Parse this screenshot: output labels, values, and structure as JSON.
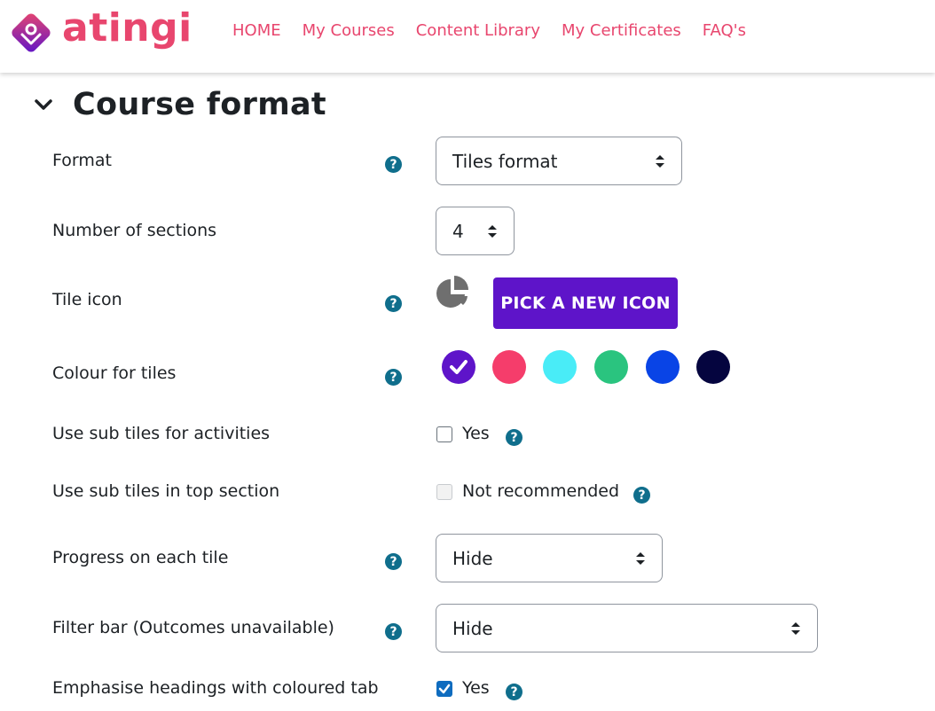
{
  "header": {
    "logo_text": "atingi",
    "nav": [
      "HOME",
      "My Courses",
      "Content Library",
      "My Certificates",
      "FAQ's"
    ]
  },
  "section": {
    "title": "Course format"
  },
  "fields": {
    "format": {
      "label": "Format",
      "value": "Tiles format"
    },
    "num_sections": {
      "label": "Number of sections",
      "value": "4"
    },
    "tile_icon": {
      "label": "Tile icon",
      "icon": "pie-chart-icon",
      "button_label": "PICK A NEW ICON"
    },
    "tile_colour": {
      "label": "Colour for tiles",
      "colours": [
        "#5e14c9",
        "#f53d6b",
        "#49ecf7",
        "#2ac47f",
        "#0944e6",
        "#05053f"
      ],
      "selected_index": 0
    },
    "sub_tiles_activities": {
      "label": "Use sub tiles for activities",
      "option": "Yes",
      "checked": false
    },
    "sub_tiles_top": {
      "label": "Use sub tiles in top section",
      "option": "Not recommended",
      "checked": false,
      "disabled": true
    },
    "progress": {
      "label": "Progress on each tile",
      "value": "Hide"
    },
    "filter_bar": {
      "label": "Filter bar (Outcomes unavailable)",
      "value": "Hide"
    },
    "emphasise": {
      "label": "Emphasise headings with coloured tab",
      "option": "Yes",
      "checked": true
    }
  },
  "colors": {
    "accent": "#e8466e",
    "help": "#0f6e8c",
    "button": "#5e14c9"
  }
}
